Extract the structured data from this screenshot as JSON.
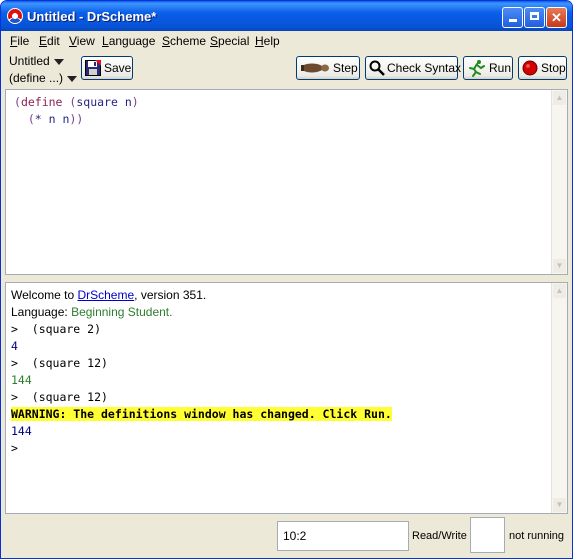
{
  "window": {
    "title": "Untitled - DrScheme*"
  },
  "menu": [
    "File",
    "Edit",
    "View",
    "Language",
    "Scheme",
    "Special",
    "Help"
  ],
  "toolbar": {
    "file_name": "Untitled",
    "define_menu": "(define ...)",
    "save_label": "Save",
    "step_label": "Step",
    "check_syntax_label": "Check Syntax",
    "run_label": "Run",
    "stop_label": "Stop"
  },
  "definitions": {
    "lines": [
      [
        [
          "paren",
          "("
        ],
        [
          "kw",
          "define"
        ],
        [
          "plain",
          " "
        ],
        [
          "paren",
          "("
        ],
        [
          "ident",
          "square"
        ],
        [
          "plain",
          " "
        ],
        [
          "ident",
          "n"
        ],
        [
          "paren",
          ")"
        ]
      ],
      [
        [
          "plain",
          "  "
        ],
        [
          "paren",
          "("
        ],
        [
          "ident",
          "*"
        ],
        [
          "plain",
          " "
        ],
        [
          "ident",
          "n"
        ],
        [
          "plain",
          " "
        ],
        [
          "ident",
          "n"
        ],
        [
          "paren",
          "))"
        ]
      ]
    ]
  },
  "interactions": {
    "welcome_prefix": "Welcome to ",
    "welcome_link": "DrScheme",
    "welcome_suffix": ", version 351.",
    "language_prefix": "Language: ",
    "language_name": "Beginning Student",
    "language_suffix": ".",
    "prompt1": ">  (square 2)",
    "out1": "4",
    "prompt2": ">  (square 12)",
    "out2": "144",
    "prompt3": ">  (square 12)",
    "warning": "WARNING: The definitions window has changed. Click Run.",
    "out3": "144",
    "prompt4": ">"
  },
  "statusbar": {
    "position": "10:2",
    "mode": "Read/Write",
    "state": "not running"
  },
  "icons": {
    "app": "drscheme-logo-icon",
    "save": "floppy-disk-icon",
    "step": "footprint-icon",
    "check": "magnifier-icon",
    "run": "running-man-icon",
    "stop": "stop-circle-icon"
  },
  "colors": {
    "titlebar": "#0a5ee8",
    "keyword": "#8b2252",
    "identifier": "#262680",
    "language": "#2e7d2e",
    "warning_bg": "#ffff33"
  }
}
